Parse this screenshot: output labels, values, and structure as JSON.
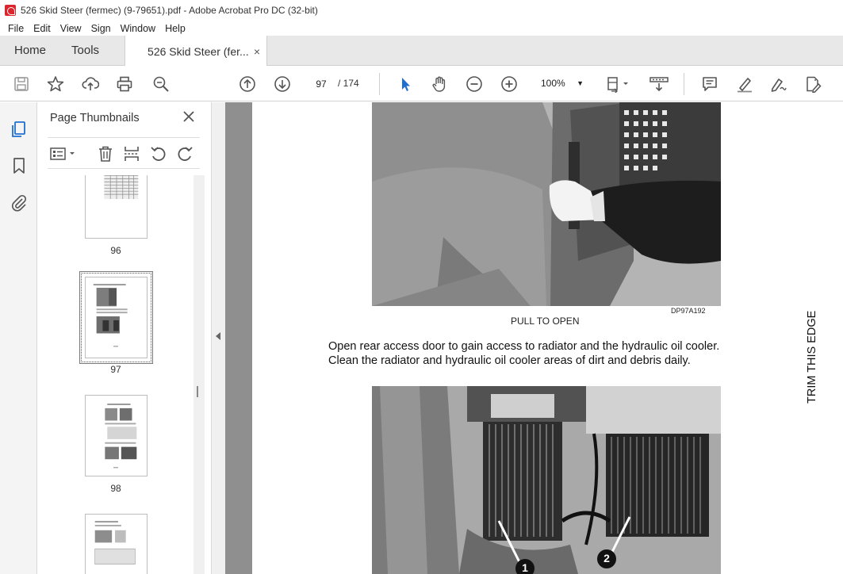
{
  "window": {
    "title": "526 Skid Steer (fermec) (9-79651).pdf - Adobe Acrobat Pro DC (32-bit)"
  },
  "menu": [
    "File",
    "Edit",
    "View",
    "Sign",
    "Window",
    "Help"
  ],
  "tabs": {
    "home": "Home",
    "tools": "Tools",
    "document": "526 Skid Steer (fer...",
    "close": "×"
  },
  "toolbar": {
    "current_page": "97",
    "total_pages": "/ 174",
    "zoom": "100%"
  },
  "sidebar": {
    "title": "Page Thumbnails",
    "close": "✕",
    "thumbnails": [
      {
        "label": "96"
      },
      {
        "label": "97",
        "selected": true
      },
      {
        "label": "98"
      },
      {
        "label": ""
      }
    ]
  },
  "document": {
    "figure1_id": "DP97A192",
    "figure1_caption": "PULL TO OPEN",
    "body_line1": "Open rear access door to gain access to radiator and the hydraulic oil cooler.",
    "body_line2": "Clean the radiator and hydraulic oil cooler areas of dirt and debris daily.",
    "callout1": "1",
    "callout2": "2",
    "trim_text": "TRIM THIS EDGE"
  },
  "icons": {
    "save": "save-icon",
    "bookmark": "star-icon",
    "share": "upload-icon",
    "print": "print-icon",
    "find": "search-zoom-icon",
    "prev": "arrow-up-circle-icon",
    "next": "arrow-down-circle-icon",
    "select": "cursor-icon",
    "hand": "hand-icon",
    "zoom_out": "minus-circle-icon",
    "zoom_in": "plus-circle-icon"
  }
}
